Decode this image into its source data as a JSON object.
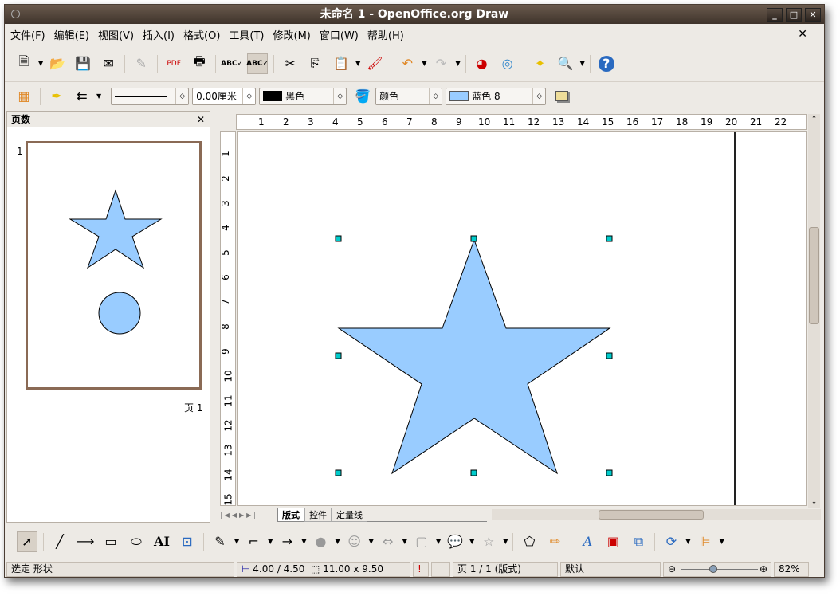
{
  "window": {
    "title": "未命名 1 - OpenOffice.org Draw",
    "minimize": "_",
    "maximize": "□",
    "close": "✕"
  },
  "menu": [
    "文件(F)",
    "编辑(E)",
    "视图(V)",
    "插入(I)",
    "格式(O)",
    "工具(T)",
    "修改(M)",
    "窗口(W)",
    "帮助(H)"
  ],
  "menu_close": "✕",
  "line_props": {
    "width": "0.00厘米",
    "line_color": "黑色",
    "area_style": "颜色",
    "area_color": "蓝色 8",
    "line_color_hex": "#000000",
    "area_color_hex": "#99ccff"
  },
  "pages_panel": {
    "title": "页数",
    "close": "✕",
    "page_number": "1",
    "page_label": "页 1"
  },
  "ruler_top": [
    "1",
    "2",
    "3",
    "4",
    "5",
    "6",
    "7",
    "8",
    "9",
    "10",
    "11",
    "12",
    "13",
    "14",
    "15",
    "16",
    "17",
    "18",
    "19",
    "20",
    "21",
    "22"
  ],
  "ruler_left": [
    "1",
    "2",
    "3",
    "4",
    "5",
    "6",
    "7",
    "8",
    "9",
    "10",
    "11",
    "12",
    "13",
    "14",
    "15"
  ],
  "tabs": [
    "版式",
    "控件",
    "定量线"
  ],
  "status": {
    "mode": "选定 形状",
    "position": "4.00 / 4.50",
    "size": "11.00 x 9.50",
    "page": "页 1 / 1 (版式)",
    "style": "默认",
    "zoom": "82%",
    "zoom_level": 0.42
  },
  "colors": {
    "shape_fill": "#99ccff",
    "titlebar": "#4e4137"
  }
}
